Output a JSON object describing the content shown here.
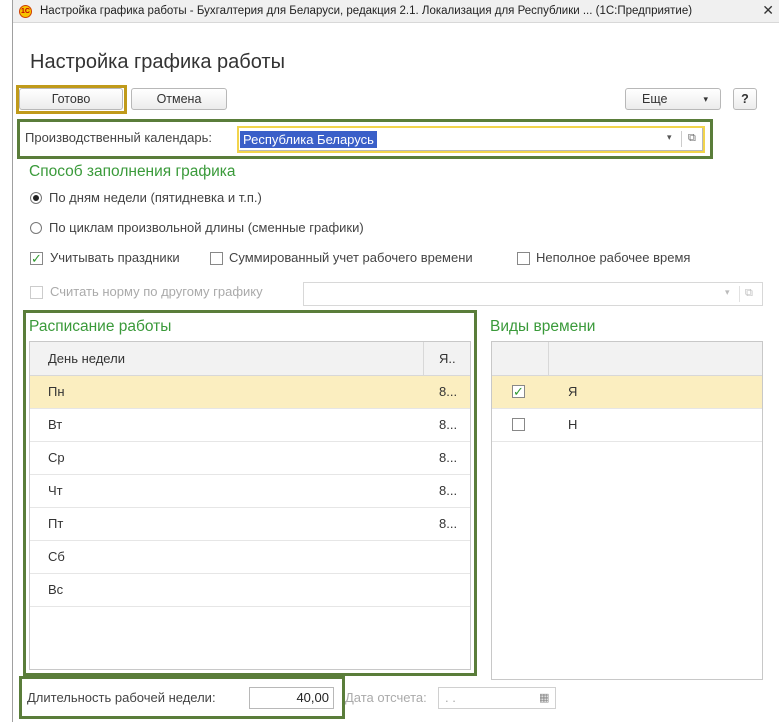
{
  "window": {
    "title": "Настройка графика работы - Бухгалтерия для Беларуси, редакция 2.1. Локализация для Республики ... (1С:Предприятие)",
    "close_glyph": "✕",
    "app_icon_text": "1С"
  },
  "form": {
    "title": "Настройка графика работы"
  },
  "toolbar": {
    "ok_label": "Готово",
    "cancel_label": "Отмена",
    "more_label": "Еще",
    "more_arrow": "▾",
    "help_label": "?"
  },
  "calendar": {
    "label": "Производственный календарь:",
    "value": "Республика Беларусь",
    "dropdown_glyph": "▾",
    "open_glyph": "⧉"
  },
  "fill_method": {
    "title": "Способ заполнения графика",
    "options": [
      {
        "label": "По дням недели (пятидневка и т.п.)",
        "selected": true
      },
      {
        "label": "По циклам произвольной длины (сменные графики)",
        "selected": false
      }
    ]
  },
  "options": {
    "holidays": {
      "label": "Учитывать праздники",
      "checked": true,
      "mark": "✓"
    },
    "summarized": {
      "label": "Суммированный учет рабочего времени",
      "checked": false
    },
    "part_time": {
      "label": "Неполное рабочее время",
      "checked": false
    },
    "other_schedule": {
      "label": "Считать норму по другому графику",
      "checked": false,
      "disabled": true,
      "dropdown_glyph": "▾",
      "open_glyph": "⧉"
    }
  },
  "schedule": {
    "title": "Расписание работы",
    "columns": [
      "День недели",
      "Я.."
    ],
    "rows": [
      {
        "day": "Пн",
        "value": "8..."
      },
      {
        "day": "Вт",
        "value": "8..."
      },
      {
        "day": "Ср",
        "value": "8..."
      },
      {
        "day": "Чт",
        "value": "8..."
      },
      {
        "day": "Пт",
        "value": "8..."
      },
      {
        "day": "Сб",
        "value": ""
      },
      {
        "day": "Вс",
        "value": ""
      }
    ]
  },
  "time_types": {
    "title": "Виды времени",
    "rows": [
      {
        "code": "Я",
        "checked": true,
        "mark": "✓"
      },
      {
        "code": "Н",
        "checked": false
      }
    ]
  },
  "footer": {
    "week_label": "Длительность рабочей недели:",
    "week_value": "40,00",
    "date_label": "Дата отсчета:",
    "date_value": ". .",
    "calendar_glyph": "▦"
  },
  "colors": {
    "accent_green": "#3a9a3a",
    "highlight_gold": "#c09a1a",
    "highlight_green": "#5a7d3a",
    "selection_blue": "#3a5fc8",
    "row_selected": "#fbeec0"
  }
}
